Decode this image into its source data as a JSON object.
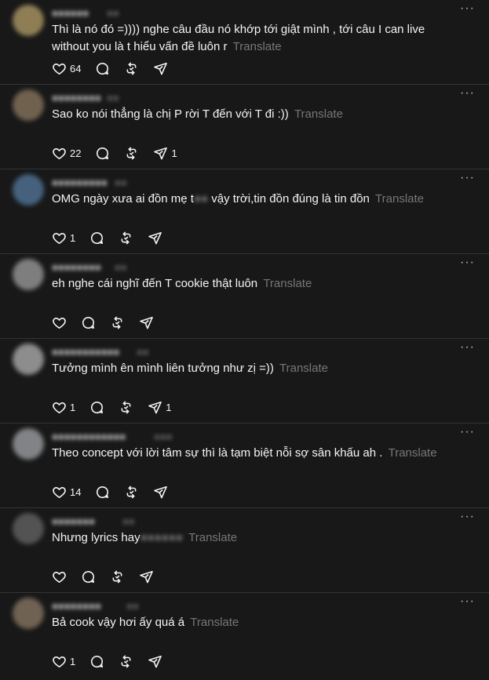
{
  "translate_label": "Translate",
  "more_label": "···",
  "icons": {
    "like": "heart-icon",
    "reply": "speech-bubble-icon",
    "repost": "repost-icon",
    "share": "send-icon",
    "more": "more-dots-icon"
  },
  "colors": {
    "background": "#181818",
    "divider": "#333333",
    "text": "#f3f5f7",
    "muted": "#777777"
  },
  "comments": [
    {
      "username": "●●●●●●",
      "time": "●●",
      "text": "Thì là nó đó =)))) nghe câu đầu nó khớp tới giật mình , tới câu I can live without you là t hiểu vấn đề luôn r",
      "likes": "64",
      "shares": "",
      "avatar_color": "#9c8a5c"
    },
    {
      "username": "●●●●●●●●",
      "time": "●●",
      "text": "Sao ko nói thẳng là chị P rời T đến với T đi :))",
      "likes": "22",
      "shares": "1",
      "avatar_color": "#7a6a55"
    },
    {
      "username": "●●●●●●●●●",
      "time": "●●",
      "text_before": "OMG ngày xưa ai đồn mẹ t",
      "text_redacted": "●●",
      "text_after": " vậy trời,tin đồn đúng là tin đồn",
      "likes": "1",
      "shares": "",
      "avatar_color": "#4a6a8a"
    },
    {
      "username": "●●●●●●●●",
      "time": "●●",
      "text": "eh nghe cái nghĩ đến T cookie thật luôn",
      "likes": "",
      "shares": "",
      "avatar_color": "#8a8a8a"
    },
    {
      "username": "●●●●●●●●●●●",
      "time": "●●",
      "text": "Tưởng mình ên mình liên tưởng như zị =))",
      "likes": "1",
      "shares": "1",
      "avatar_color": "#9a9a9a"
    },
    {
      "username": "●●●●●●●●●●●●",
      "time": "●●●",
      "text": "Theo concept với lời tâm sự thì là tạm biệt nỗi sợ sân khấu ah .",
      "likes": "14",
      "shares": "",
      "avatar_color": "#8d8f92"
    },
    {
      "username": "●●●●●●●",
      "time": "●●",
      "text_before": "Nhưng lyrics hay",
      "text_redacted": "●●●●●●",
      "text_after": " ",
      "likes": "",
      "shares": "",
      "avatar_color": "#5a5a5a"
    },
    {
      "username": "●●●●●●●●",
      "time": "●●",
      "text": "Bả cook vậy hơi ấy quá á",
      "likes": "1",
      "shares": "",
      "avatar_color": "#7a6b5a"
    }
  ]
}
